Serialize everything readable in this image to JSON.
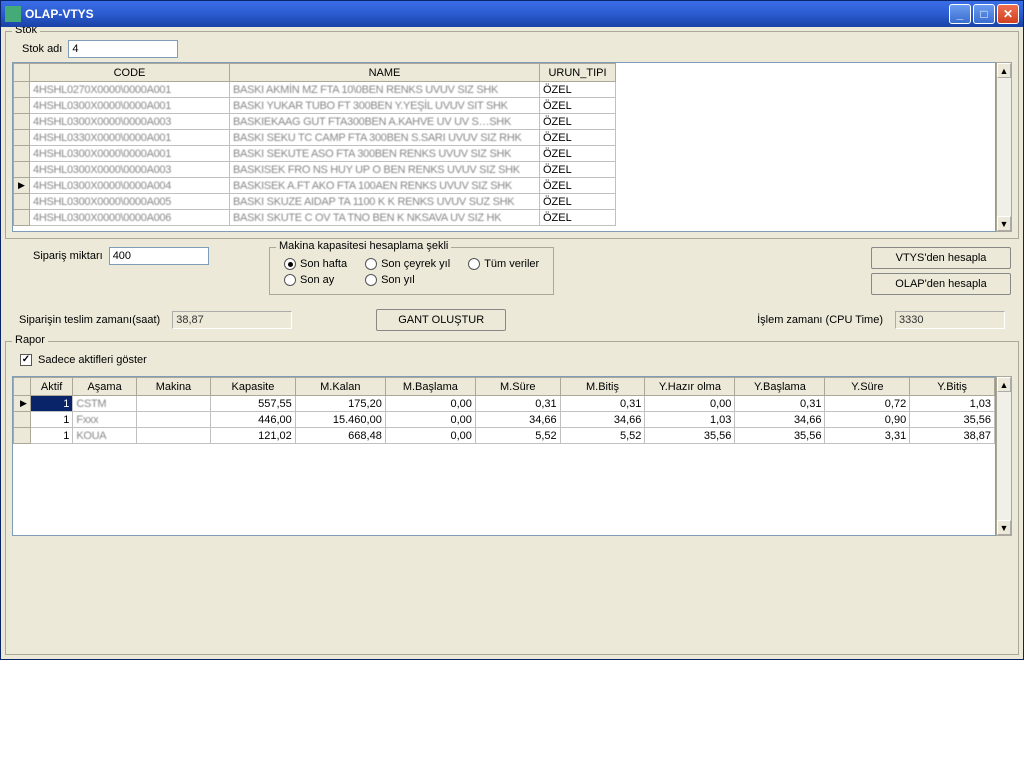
{
  "window": {
    "title": "OLAP-VTYS"
  },
  "stok": {
    "legend": "Stok",
    "name_label": "Stok adı",
    "name_value": "4",
    "columns": {
      "code": "CODE",
      "name": "NAME",
      "urun_tipi": "URUN_TIPI"
    },
    "rows": [
      {
        "code": "4HSHL0270X0000\\0000A001",
        "name": "BASKI AKMİN MZ FTA 10\\0BEN RENKS UVUV SIZ SHK",
        "urun_tipi": "ÖZEL",
        "marker": ""
      },
      {
        "code": "4HSHL0300X0000\\0000A001",
        "name": "BASKI YUKAR TUBO FT 300BEN Y.YEŞİL UVUV SIT SHK",
        "urun_tipi": "ÖZEL",
        "marker": ""
      },
      {
        "code": "4HSHL0300X0000\\0000A003",
        "name": "BASKIEKAAG GUT FTA300BEN A.KAHVE UV UV S…SHK",
        "urun_tipi": "ÖZEL",
        "marker": ""
      },
      {
        "code": "4HSHL0330X0000\\0000A001",
        "name": "BASKI SEKU TC CAMP FTA 300BEN S.SARI UVUV SIZ RHK",
        "urun_tipi": "ÖZEL",
        "marker": ""
      },
      {
        "code": "4HSHL0300X0000\\0000A001",
        "name": "BASKI SEKUTE ASO FTA 300BEN RENKS UVUV SIZ SHK",
        "urun_tipi": "ÖZEL",
        "marker": ""
      },
      {
        "code": "4HSHL0300X0000\\0000A003",
        "name": "BASKISEK FRO NS HUY UP O BEN RENKS UVUV SIZ SHK",
        "urun_tipi": "ÖZEL",
        "marker": ""
      },
      {
        "code": "4HSHL0300X0000\\0000A004",
        "name": "BASKISEK A.FT AKO FTA 100AEN RENKS UVUV SIZ SHK",
        "urun_tipi": "ÖZEL",
        "marker": "▶"
      },
      {
        "code": "4HSHL0300X0000\\0000A005",
        "name": "BASKI SKUZE AIDAP TA 1100 K K RENKS UVUV SUZ SHK",
        "urun_tipi": "ÖZEL",
        "marker": ""
      },
      {
        "code": "4HSHL0300X0000\\0000A006",
        "name": "BASKI SKUTE C OV TA TNO BEN K NKSAVA UV SIZ HK",
        "urun_tipi": "ÖZEL",
        "marker": ""
      }
    ]
  },
  "siparis": {
    "miktar_label": "Sipariş miktarı",
    "miktar_value": "400",
    "kapasite_legend": "Makina kapasitesi hesaplama şekli",
    "radios": {
      "son_hafta": "Son hafta",
      "son_ceyrek": "Son çeyrek yıl",
      "tum_veriler": "Tüm veriler",
      "son_ay": "Son ay",
      "son_yil": "Son yıl"
    },
    "buttons": {
      "vtys": "VTYS'den hesapla",
      "olap": "OLAP'den hesapla"
    }
  },
  "calc": {
    "teslim_label": "Siparişin teslim zamanı(saat)",
    "teslim_value": "38,87",
    "gant_button": "GANT OLUŞTUR",
    "cpu_label": "İşlem zamanı (CPU Time)",
    "cpu_value": "3330"
  },
  "rapor": {
    "legend": "Rapor",
    "aktif_label": "Sadece aktifleri göster",
    "aktif_checked": true,
    "columns": [
      "Aktif",
      "Aşama",
      "Makina",
      "Kapasite",
      "M.Kalan",
      "M.Başlama",
      "M.Süre",
      "M.Bitiş",
      "Y.Hazır olma",
      "Y.Başlama",
      "Y.Süre",
      "Y.Bitiş"
    ],
    "rows": [
      {
        "marker": "▶",
        "aktif": "1",
        "asama": "CSTM",
        "makina": "",
        "kapasite": "557,55",
        "mkalan": "175,20",
        "mbaslama": "0,00",
        "msure": "0,31",
        "mbitis": "0,31",
        "yhazir": "0,00",
        "ybaslama": "0,31",
        "ysure": "0,72",
        "ybitis": "1,03",
        "sel": true
      },
      {
        "marker": "",
        "aktif": "1",
        "asama": "Fxxx",
        "makina": "",
        "kapasite": "446,00",
        "mkalan": "15.460,00",
        "mbaslama": "0,00",
        "msure": "34,66",
        "mbitis": "34,66",
        "yhazir": "1,03",
        "ybaslama": "34,66",
        "ysure": "0,90",
        "ybitis": "35,56",
        "sel": false
      },
      {
        "marker": "",
        "aktif": "1",
        "asama": "KOUA",
        "makina": "",
        "kapasite": "121,02",
        "mkalan": "668,48",
        "mbaslama": "0,00",
        "msure": "5,52",
        "mbitis": "5,52",
        "yhazir": "35,56",
        "ybaslama": "35,56",
        "ysure": "3,31",
        "ybitis": "38,87",
        "sel": false
      }
    ]
  }
}
